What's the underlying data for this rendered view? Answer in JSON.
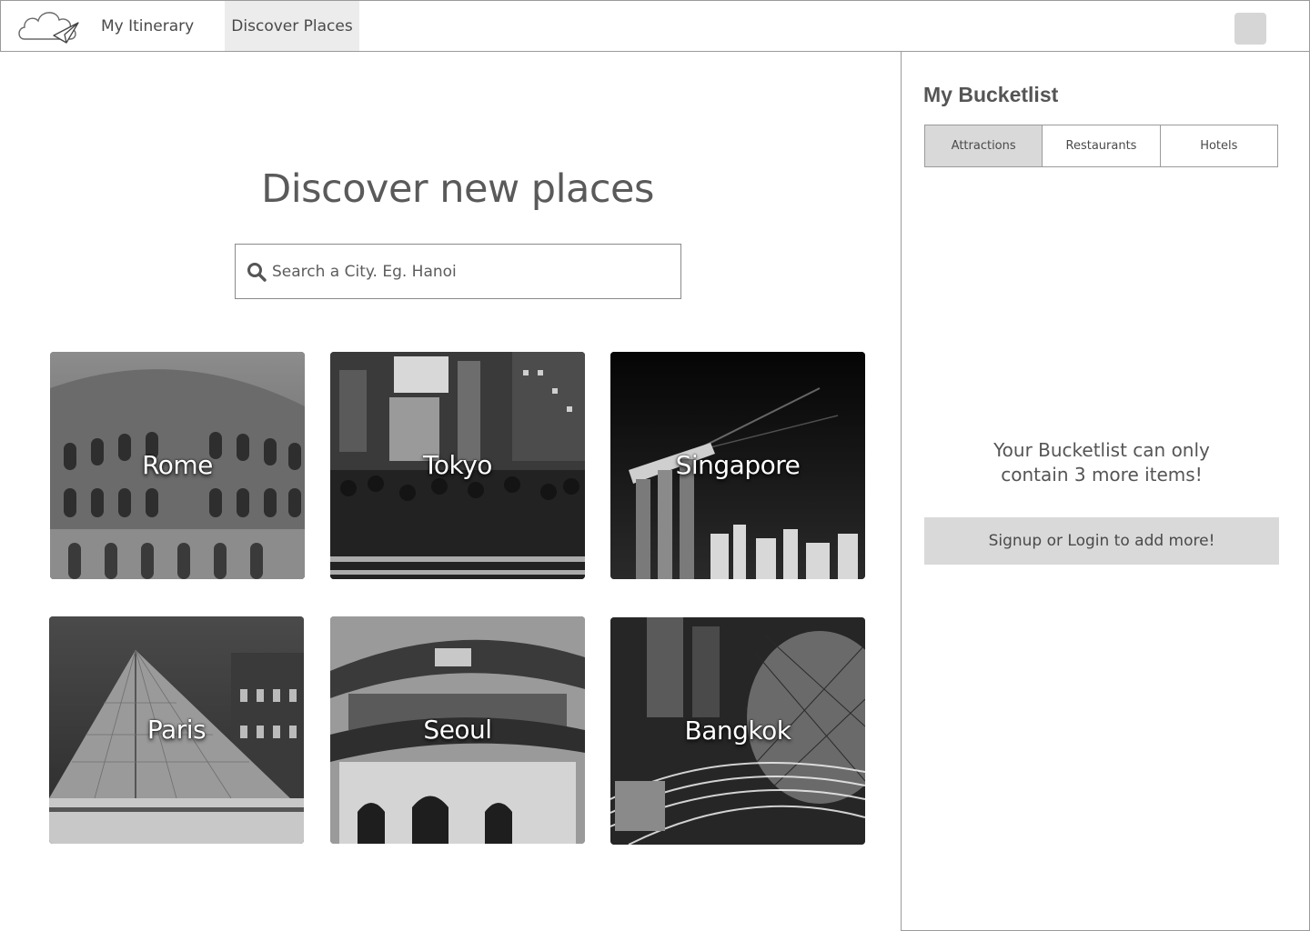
{
  "nav": {
    "items": [
      {
        "label": "My Itinerary"
      },
      {
        "label": "Discover Places"
      }
    ],
    "logo_icon": "cloud-paper-plane-icon",
    "avatar_icon": "avatar-placeholder"
  },
  "main": {
    "title": "Discover new places",
    "search": {
      "placeholder": "Search a City. Eg. Hanoi",
      "value": "",
      "icon": "search-icon"
    },
    "cities": [
      {
        "name": "Rome"
      },
      {
        "name": "Tokyo"
      },
      {
        "name": "Singapore"
      },
      {
        "name": "Paris"
      },
      {
        "name": "Seoul"
      },
      {
        "name": "Bangkok"
      }
    ]
  },
  "sidebar": {
    "title": "My Bucketlist",
    "tabs": [
      {
        "label": "Attractions",
        "active": true
      },
      {
        "label": "Restaurants",
        "active": false
      },
      {
        "label": "Hotels",
        "active": false
      }
    ],
    "limit_message_line1": "Your Bucketlist can only",
    "limit_message_line2": "contain 3 more items!",
    "signup_label": "Signup or Login to add more!"
  },
  "colors": {
    "border": "#9a9a9a",
    "active_tab": "#d9d9d9",
    "nav_active": "#ececec"
  }
}
